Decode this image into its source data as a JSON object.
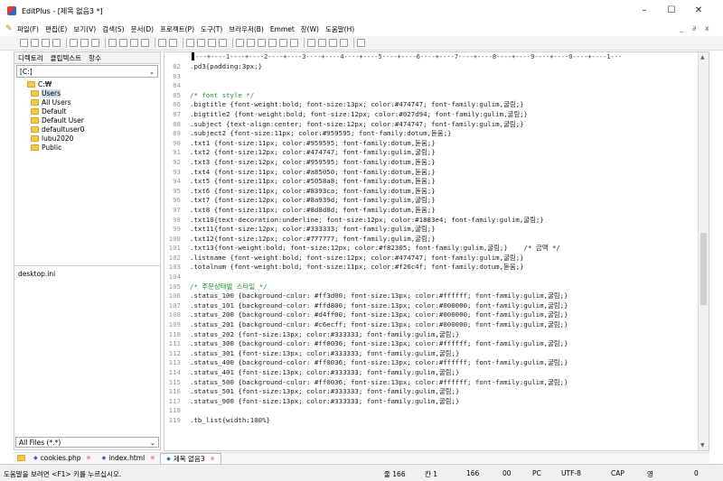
{
  "window": {
    "title": "EditPlus - [제목 없음3 *]",
    "minimize": "–",
    "maximize": "☐",
    "close": "✕"
  },
  "menu": [
    "파일(F)",
    "편집(E)",
    "보기(V)",
    "검색(S)",
    "문서(D)",
    "프로젝트(P)",
    "도구(T)",
    "브라우저(B)",
    "Emmet",
    "창(W)",
    "도움말(H)"
  ],
  "mdi_controls": [
    "_",
    "∂",
    "x"
  ],
  "sidebar": {
    "tabs": [
      "디렉토리",
      "클립텍스트",
      "항수"
    ],
    "drive": "[C:]",
    "tree": [
      "C:₩",
      "Users",
      "All Users",
      "Default",
      "Default User",
      "defaultuser0",
      "lubu2020",
      "Public"
    ],
    "files": [
      "desktop.ini"
    ],
    "filter": "All Files (*.*)"
  },
  "ruler": "----+----1----+----2----+----3----+----4----+----5----+----6----+----7----+----8----+----9----+----0----+----1---",
  "code_lines": [
    {
      "n": "82",
      "t": ".pd3{padding:3px;}"
    },
    {
      "n": "83",
      "t": ""
    },
    {
      "n": "84",
      "t": ""
    },
    {
      "n": "85",
      "t": "/* font style */",
      "c": "comment"
    },
    {
      "n": "86",
      "t": ".bigtitle {font-weight:bold; font-size:13px; color:#474747; font-family:gulim,굴림;}"
    },
    {
      "n": "87",
      "t": ".bigtitle2 {font-weight:bold; font-size:12px; color:#027d94; font-family:gulim,굴림;}"
    },
    {
      "n": "88",
      "t": ".subject {text-align:center; font-size:12px; color:#474747; font-family:gulim,굴림;}"
    },
    {
      "n": "89",
      "t": ".subject2 {font-size:11px; color:#959595; font-family:dotum,돋움;}"
    },
    {
      "n": "90",
      "t": ".txt1 {font-size:11px; color:#959595; font-family:dotum,돋움;}"
    },
    {
      "n": "91",
      "t": ".txt2 {font-size:12px; color:#474747; font-family:gulim,굴림;}"
    },
    {
      "n": "92",
      "t": ".txt3 {font-size:12px; color:#959595; font-family:dotum,돋움;}"
    },
    {
      "n": "93",
      "t": ".txt4 {font-size:11px; color:#a85050; font-family:dotum,돋움;}"
    },
    {
      "n": "94",
      "t": ".txt5 {font-size:11px; color:#5058a8; font-family:dotum,돋움;}"
    },
    {
      "n": "95",
      "t": ".txt6 {font-size:11px; color:#8393ca; font-family:dotum,돋움;}"
    },
    {
      "n": "96",
      "t": ".txt7 {font-size:12px; color:#8a939d; font-family:gulim,굴림;}"
    },
    {
      "n": "97",
      "t": ".txt8 {font-size:11px; color:#8d8d8d; font-family:dotum,돋움;}"
    },
    {
      "n": "98",
      "t": ".txt10{text-decoration:underline; font-size:12px; color:#1883e4; font-family:gulim,굴림;}"
    },
    {
      "n": "99",
      "t": ".txt11{font-size:12px; color:#333333; font-family:gulim,굴림;}"
    },
    {
      "n": "100",
      "t": ".txt12{font-size:12px; color:#777777; font-family:gulim,굴림;}"
    },
    {
      "n": "101",
      "t": ".txt13{font-weight:bold; font-size:12px; color:#f82305; font-family:gulim,굴림;}    /* 금액 */"
    },
    {
      "n": "102",
      "t": ".listname {font-weight:bold; font-size:12px; color:#474747; font-family:gulim,굴림;}"
    },
    {
      "n": "103",
      "t": ".totalnum {font-weight:bold; font-size:11px; color:#f26c4f; font-family:dotum,돋움;}"
    },
    {
      "n": "104",
      "t": ""
    },
    {
      "n": "105",
      "t": "/* 주문상태별 스타일 */",
      "c": "comment"
    },
    {
      "n": "106",
      "t": ".status_100 {background-color: #ff3d00; font-size:13px; color:#ffffff; font-family:gulim,굴림;}"
    },
    {
      "n": "107",
      "t": ".status_101 {background-color: #ffd800; font-size:13px; color:#000000; font-family:gulim,굴림;}"
    },
    {
      "n": "108",
      "t": ".status_200 {background-color: #d4ff00; font-size:13px; color:#000000; font-family:gulim,굴림;}"
    },
    {
      "n": "109",
      "t": ".status_201 {background-color: #c6ecff; font-size:13px; color:#000000; font-family:gulim,굴림;}"
    },
    {
      "n": "110",
      "t": ".status_202 {font-size:13px; color:#333333; font-family:gulim,굴림;}"
    },
    {
      "n": "111",
      "t": ".status_300 {background-color: #ff0036; font-size:13px; color:#ffffff; font-family:gulim,굴림;}"
    },
    {
      "n": "112",
      "t": ".status_301 {font-size:13px; color:#333333; font-family:gulim,굴림;}"
    },
    {
      "n": "113",
      "t": ".status_400 {background-color: #ff0036; font-size:13px; color:#ffffff; font-family:gulim,굴림;}"
    },
    {
      "n": "114",
      "t": ".status_401 {font-size:13px; color:#333333; font-family:gulim,굴림;}"
    },
    {
      "n": "115",
      "t": ".status_500 {background-color: #ff0036; font-size:13px; color:#ffffff; font-family:gulim,굴림;}"
    },
    {
      "n": "116",
      "t": ".status_501 {font-size:13px; color:#333333; font-family:gulim,굴림;}"
    },
    {
      "n": "117",
      "t": ".status_900 {font-size:13px; color:#333333; font-family:gulim,굴림;}"
    },
    {
      "n": "118",
      "t": ""
    },
    {
      "n": "119",
      "t": ".tb_list{width:100%}"
    }
  ],
  "doc_tabs": [
    {
      "label": "cookies.php",
      "close": "⊗"
    },
    {
      "label": "index.html",
      "close": "⊗"
    },
    {
      "label": "제목 없음3",
      "close": "⊗"
    }
  ],
  "status": {
    "help": "도움말을 보려면 <F1> 키를 누르십시오.",
    "line": "줄 166",
    "col": "칸 1",
    "total": "166",
    "hex": "00",
    "eol": "PC",
    "encoding": "UTF-8",
    "caps": "CAP",
    "ime": "영",
    "zero": "0"
  },
  "colors": {
    "comment": "#1a9a2a",
    "folder": "#f2c94c"
  }
}
